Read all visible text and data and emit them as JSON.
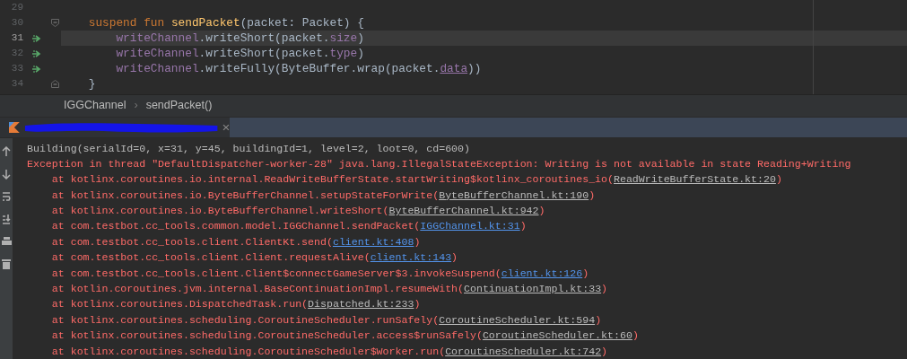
{
  "editor": {
    "lines": [
      {
        "number": "29",
        "current": false,
        "marker": false,
        "fold_start": false,
        "fold_end": false
      },
      {
        "number": "30",
        "current": false,
        "marker": false,
        "fold_start": true,
        "fold_end": false,
        "tokens": [
          {
            "t": "    suspend fun ",
            "kind": "keyword"
          },
          {
            "t": "sendPacket",
            "kind": "function"
          },
          {
            "t": "(packet: Packet) {",
            "kind": "plain"
          }
        ]
      },
      {
        "number": "31",
        "current": true,
        "marker": true,
        "fold_start": false,
        "fold_end": false,
        "tokens": [
          {
            "t": "        writeChannel",
            "kind": "field"
          },
          {
            "t": ".writeShort(packet.",
            "kind": "plain"
          },
          {
            "t": "size",
            "kind": "field"
          },
          {
            "t": ")",
            "kind": "plain"
          }
        ]
      },
      {
        "number": "32",
        "current": false,
        "marker": true,
        "fold_start": false,
        "fold_end": false,
        "tokens": [
          {
            "t": "        writeChannel",
            "kind": "field"
          },
          {
            "t": ".writeShort(packet.",
            "kind": "plain"
          },
          {
            "t": "type",
            "kind": "field"
          },
          {
            "t": ")",
            "kind": "plain"
          }
        ]
      },
      {
        "number": "33",
        "current": false,
        "marker": true,
        "fold_start": false,
        "fold_end": false,
        "tokens": [
          {
            "t": "        writeChannel",
            "kind": "field"
          },
          {
            "t": ".writeFully(ByteBuffer.wrap(packet.",
            "kind": "plain"
          },
          {
            "t": "data",
            "kind": "field_underlined"
          },
          {
            "t": "))",
            "kind": "plain"
          }
        ]
      },
      {
        "number": "34",
        "current": false,
        "marker": false,
        "fold_start": false,
        "fold_end": true,
        "tokens": [
          {
            "t": "    }",
            "kind": "plain"
          }
        ]
      }
    ]
  },
  "breadcrumbs": {
    "items": [
      "IGGChannel",
      "sendPacket()"
    ],
    "separator": "›"
  },
  "run_tab": {
    "redacted": true
  },
  "console": {
    "lines": [
      {
        "kind": "output",
        "text": "Building(serialId=0, x=31, y=45, buildingId=1, level=2, loot=0, cd=600)"
      },
      {
        "kind": "error",
        "text": "Exception in thread \"DefaultDispatcher-worker-28\" java.lang.IllegalStateException: Writing is not available in state Reading+Writing"
      },
      {
        "kind": "frame",
        "text": "    at kotlinx.coroutines.io.internal.ReadWriteBufferState.startWriting$kotlinx_coroutines_io(",
        "link": "ReadWriteBufferState.kt:20",
        "project": false,
        "tail": ")"
      },
      {
        "kind": "frame",
        "text": "    at kotlinx.coroutines.io.ByteBufferChannel.setupStateForWrite(",
        "link": "ByteBufferChannel.kt:190",
        "project": false,
        "tail": ")"
      },
      {
        "kind": "frame",
        "text": "    at kotlinx.coroutines.io.ByteBufferChannel.writeShort(",
        "link": "ByteBufferChannel.kt:942",
        "project": false,
        "tail": ")"
      },
      {
        "kind": "frame",
        "text": "    at com.testbot.cc_tools.common.model.IGGChannel.sendPacket(",
        "link": "IGGChannel.kt:31",
        "project": true,
        "tail": ")"
      },
      {
        "kind": "frame",
        "text": "    at com.testbot.cc_tools.client.ClientKt.send(",
        "link": "client.kt:408",
        "project": true,
        "tail": ")"
      },
      {
        "kind": "frame",
        "text": "    at com.testbot.cc_tools.client.Client.requestAlive(",
        "link": "client.kt:143",
        "project": true,
        "tail": ")"
      },
      {
        "kind": "frame",
        "text": "    at com.testbot.cc_tools.client.Client$connectGameServer$3.invokeSuspend(",
        "link": "client.kt:126",
        "project": true,
        "tail": ")"
      },
      {
        "kind": "frame",
        "text": "    at kotlin.coroutines.jvm.internal.BaseContinuationImpl.resumeWith(",
        "link": "ContinuationImpl.kt:33",
        "project": false,
        "tail": ")"
      },
      {
        "kind": "frame",
        "text": "    at kotlinx.coroutines.DispatchedTask.run(",
        "link": "Dispatched.kt:233",
        "project": false,
        "tail": ")"
      },
      {
        "kind": "frame",
        "text": "    at kotlinx.coroutines.scheduling.CoroutineScheduler.runSafely(",
        "link": "CoroutineScheduler.kt:594",
        "project": false,
        "tail": ")"
      },
      {
        "kind": "frame",
        "text": "    at kotlinx.coroutines.scheduling.CoroutineScheduler.access$runSafely(",
        "link": "CoroutineScheduler.kt:60",
        "project": false,
        "tail": ")"
      },
      {
        "kind": "frame",
        "text": "    at kotlinx.coroutines.scheduling.CoroutineScheduler$Worker.run(",
        "link": "CoroutineScheduler.kt:742",
        "project": false,
        "tail": ")"
      }
    ]
  }
}
